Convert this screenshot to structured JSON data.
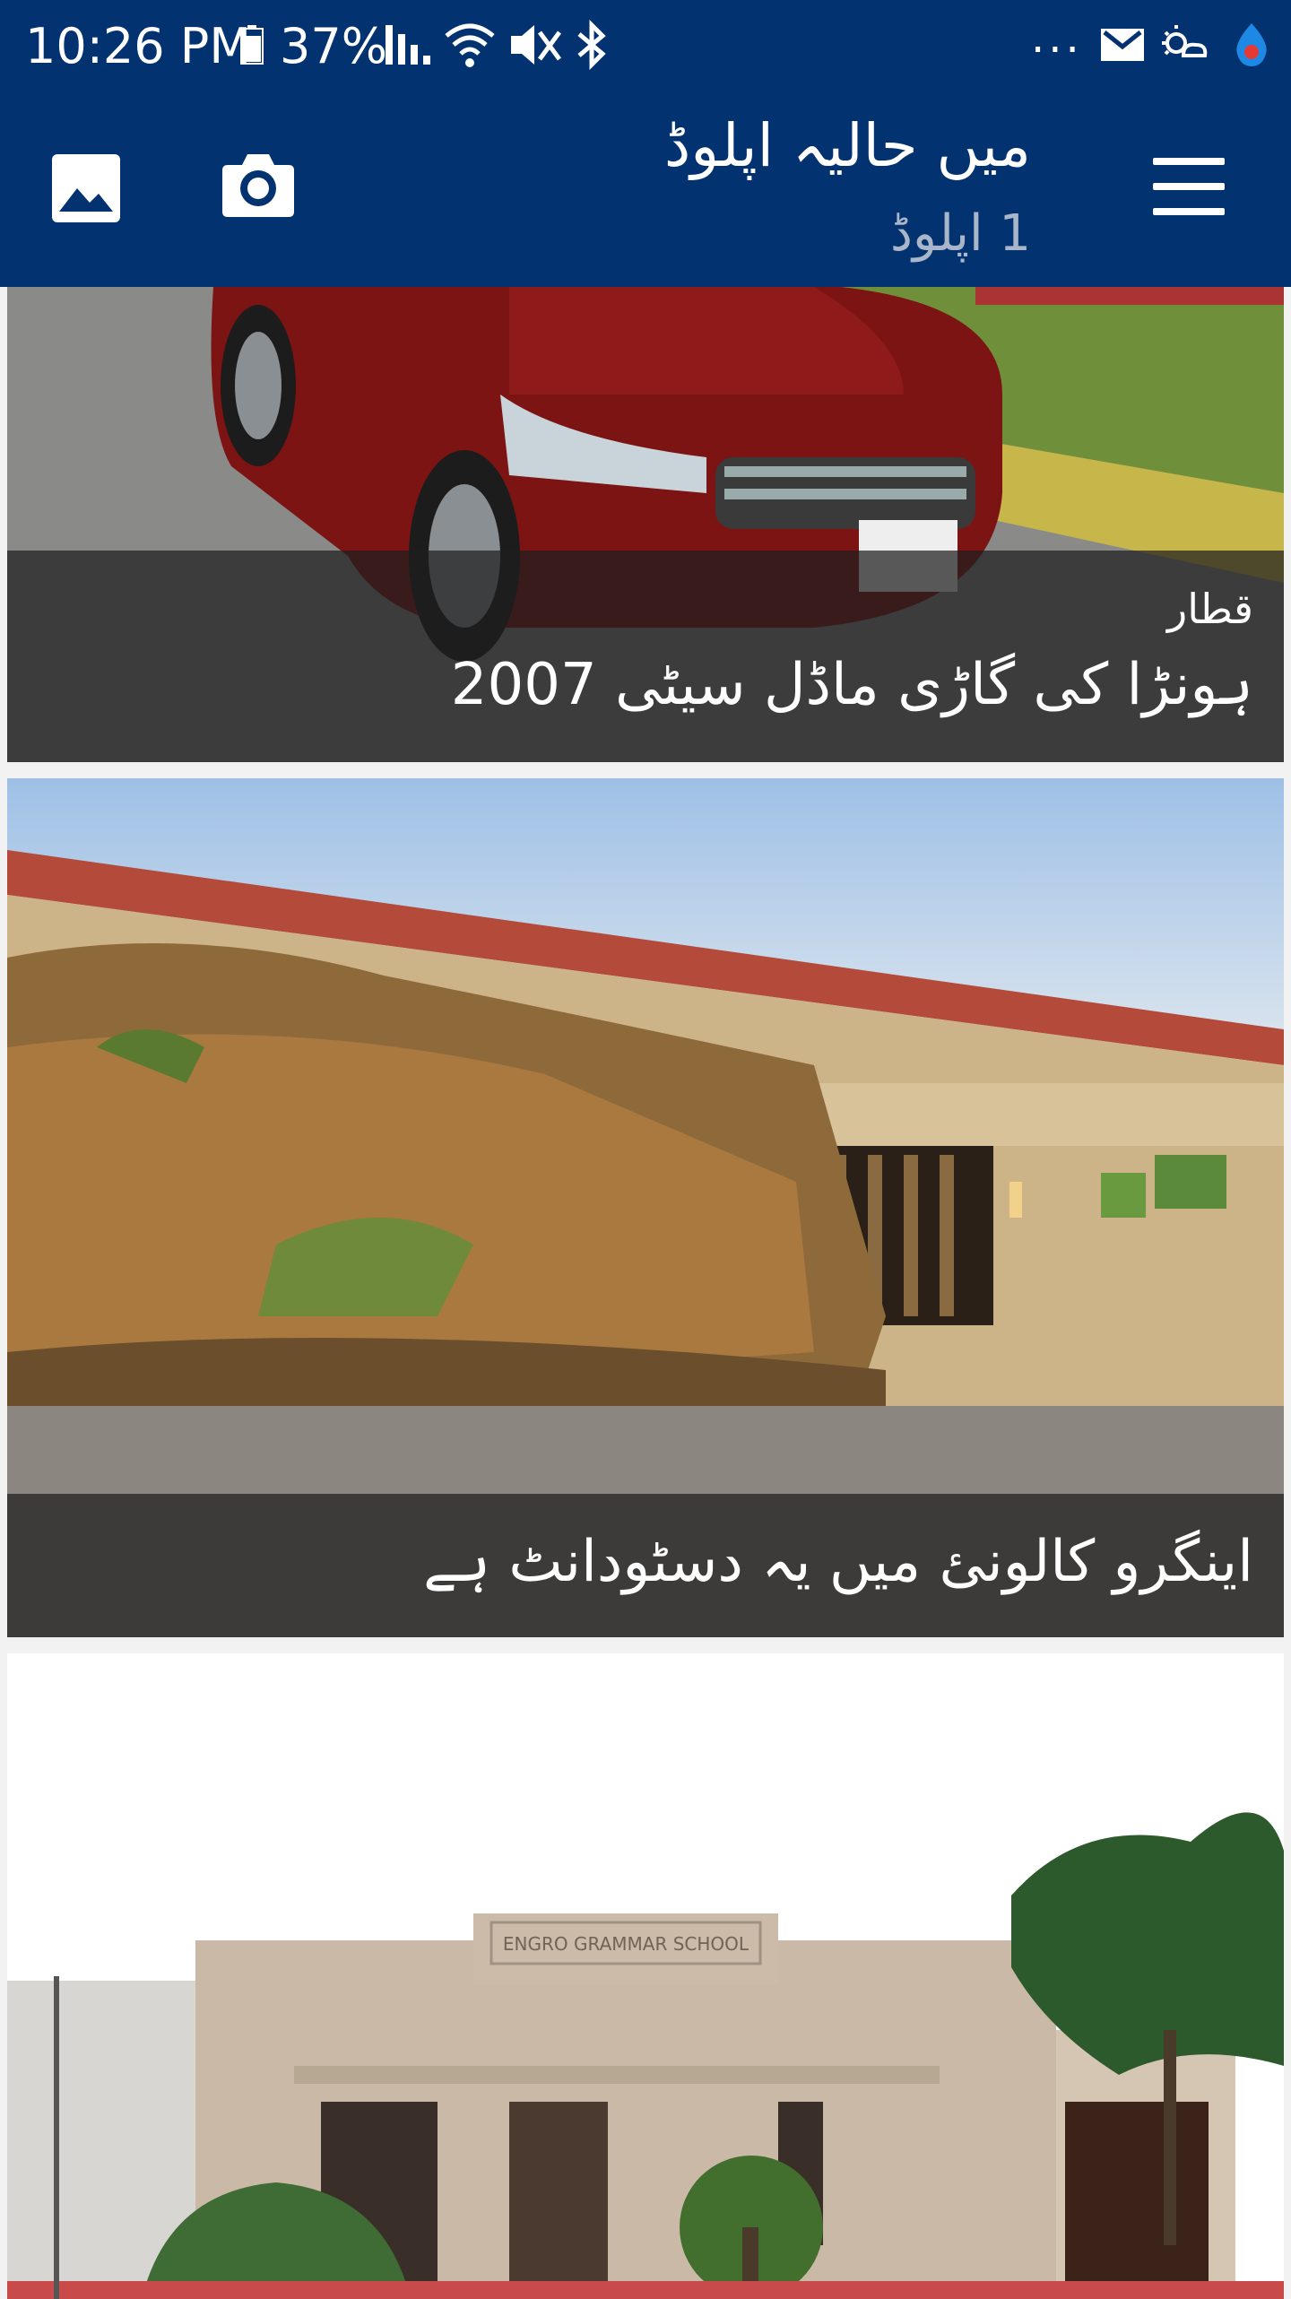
{
  "status_bar": {
    "time": "10:26 PM",
    "battery": "37%",
    "more": "..."
  },
  "app_bar": {
    "title": "میں حالیہ اپلوڈ",
    "subtitle": "1 اپلوڈ",
    "icons": [
      "gallery-icon",
      "camera-icon",
      "menu-icon"
    ]
  },
  "feed": {
    "cards": [
      {
        "location": "قطار",
        "caption": "ہونڑا کی گاڑی ماڈل سیٹی 2007",
        "photo": "car-photo"
      },
      {
        "location": "",
        "caption": "اینگرو کالونئ میں یہ دسٹودانٹ ہے",
        "photo": "restaurant-photo"
      },
      {
        "location": "",
        "caption": "",
        "photo": "school-photo",
        "sign_text": "ENGRO GRAMMAR SCHOOL"
      }
    ]
  },
  "colors": {
    "primary": "#033270",
    "caption_overlay": "#1e1e1e"
  }
}
